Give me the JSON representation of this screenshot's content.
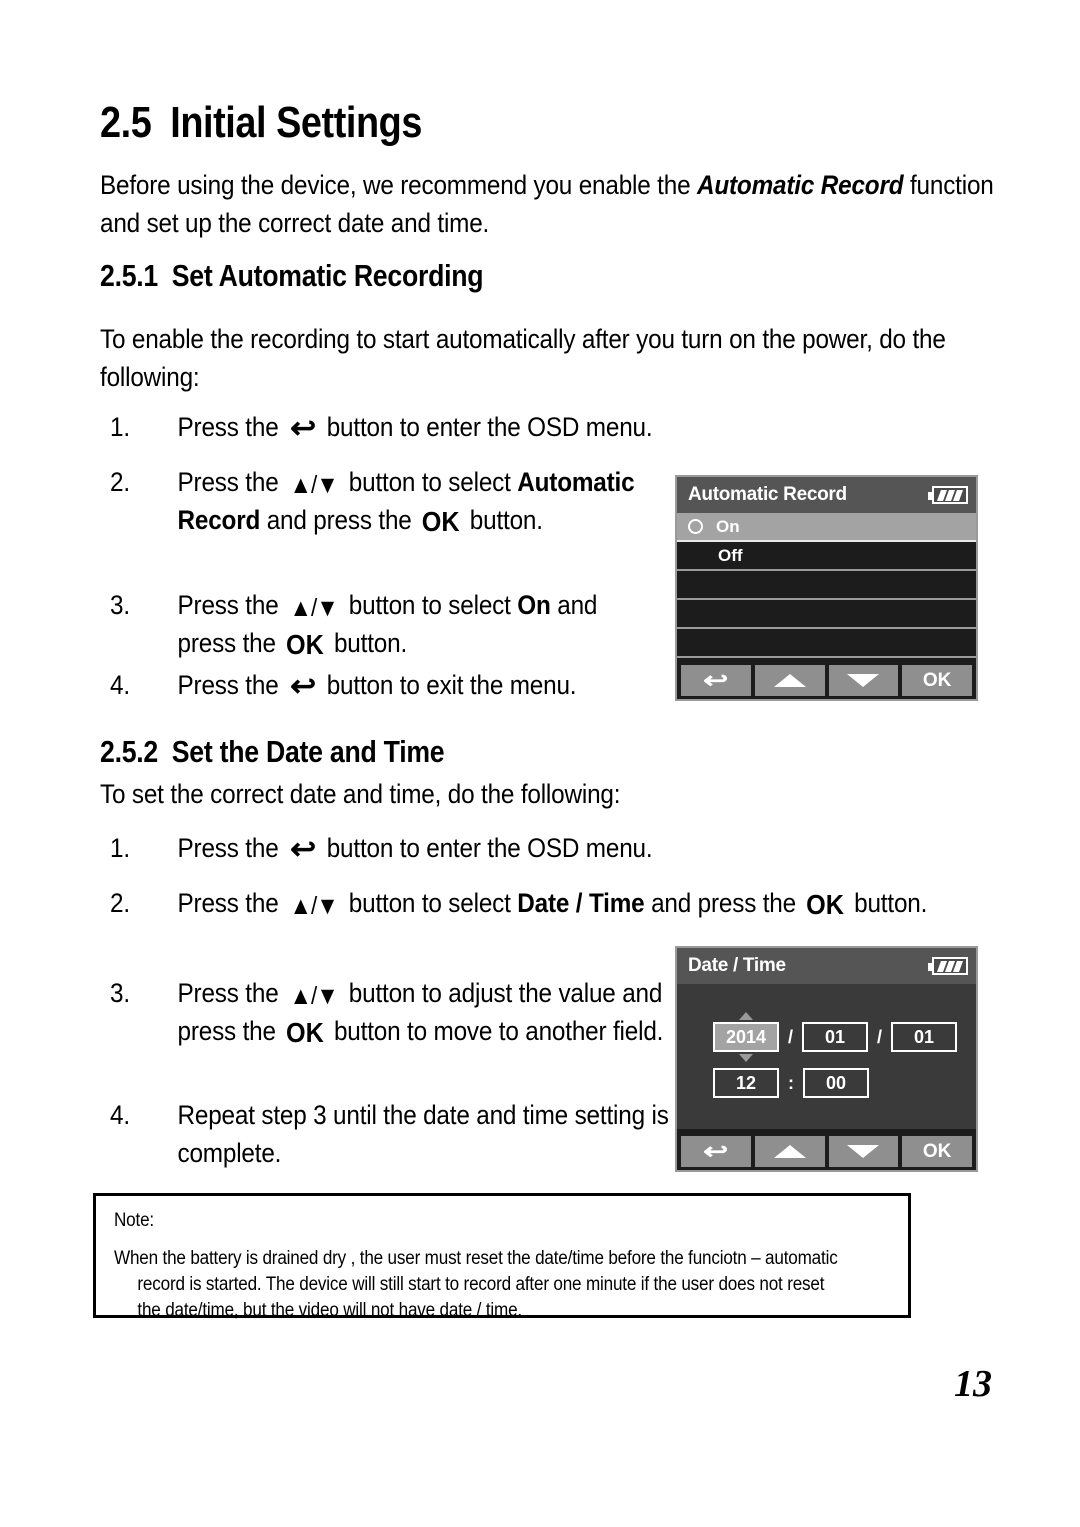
{
  "document": {
    "page_number": "13"
  },
  "section": {
    "number": "2.5",
    "title": "Initial Settings",
    "intro_1": "Before using the device, we recommend you enable the ",
    "intro_em": "Automatic Record",
    "intro_2": " function and set up the correct date and time."
  },
  "sub251": {
    "number": "2.5.1",
    "title": "Set Automatic Recording",
    "lead": "To enable the recording to start automatically after you turn on the power, do the following:",
    "steps": [
      {
        "num": "1.",
        "text_1": "Press the ",
        "icon": "back-arrow-icon",
        "icon_glyph": "↩",
        "text_2": " button to enter the OSD menu."
      },
      {
        "num": "2.",
        "text_1": "Press the ",
        "icon": "up-down-arrow-icon",
        "text_2": " button to select ",
        "bold_1": "Automatic Record",
        "text_3": " and press the ",
        "icon_2": "ok-icon",
        "icon_2_label": "OK",
        "text_4": " button."
      },
      {
        "num": "3.",
        "text_1": "Press the ",
        "icon": "up-down-arrow-icon",
        "text_2": " button to select ",
        "bold_1": "On",
        "text_3": " and press the ",
        "icon_2_label": "OK",
        "text_4": " button."
      },
      {
        "num": "4.",
        "text_1": "Press the ",
        "icon": "back-arrow-icon",
        "text_2": " button to exit the menu."
      }
    ]
  },
  "sub252": {
    "number": "2.5.2",
    "title": "Set the Date and Time",
    "lead": "To set the correct date and time, do the following:",
    "steps": [
      {
        "num": "1.",
        "text_1": "Press the ",
        "text_2": " button to enter the OSD menu."
      },
      {
        "num": "2.",
        "text_1": "Press the ",
        "text_2": " button to select ",
        "bold_1": "Date / Time",
        "text_3": " and press the ",
        "icon_2_label": "OK",
        "text_4": " button."
      },
      {
        "num": "3.",
        "text_1": "Press the ",
        "text_2": " button to adjust the value and press the ",
        "icon_2_label": "OK",
        "text_3": " button to move to another field."
      },
      {
        "num": "4.",
        "text_1": "Repeat step 3 until the date and time setting is complete."
      }
    ]
  },
  "osd_automatic_record": {
    "title": "Automatic Record",
    "battery_icon": "battery-full-icon",
    "rows": [
      {
        "label": "On",
        "selected": true,
        "has_radio": true
      },
      {
        "label": "Off",
        "selected": false,
        "has_radio": false
      },
      {
        "label": "",
        "selected": false,
        "has_radio": false
      },
      {
        "label": "",
        "selected": false,
        "has_radio": false
      },
      {
        "label": "",
        "selected": false,
        "has_radio": false
      }
    ],
    "buttons": [
      {
        "name": "back-button",
        "label": "↩"
      },
      {
        "name": "up-button",
        "label": ""
      },
      {
        "name": "down-button",
        "label": ""
      },
      {
        "name": "ok-button",
        "label": "OK"
      }
    ]
  },
  "osd_date_time": {
    "title": "Date / Time",
    "battery_icon": "battery-full-icon",
    "fields": {
      "year": "2014",
      "month": "01",
      "day": "01",
      "hour": "12",
      "minute": "00",
      "date_separator": "/",
      "time_separator": ":",
      "active_field": "year"
    },
    "buttons": [
      {
        "name": "back-button",
        "label": "↩"
      },
      {
        "name": "up-button",
        "label": ""
      },
      {
        "name": "down-button",
        "label": ""
      },
      {
        "name": "ok-button",
        "label": "OK"
      }
    ]
  },
  "note": {
    "label": "Note:",
    "line_1": "When the battery is drained dry , the user must reset the date/time before the funciotn – automatic",
    "line_2": "record is started.    The device will still start to record after one minute if the user does not reset",
    "line_3": "the date/time, but the video will not have date / time."
  },
  "colors": {
    "osd_title_bg": "#555555",
    "osd_row_bg": "#1c1c1c",
    "osd_row_selected_bg": "#a3a3a3",
    "osd_body_bg": "#3a3a3a",
    "osd_button_bg": "#8f8f8f",
    "osd_border": "#9a9a9a",
    "text": "#000000",
    "page_bg": "#ffffff"
  }
}
